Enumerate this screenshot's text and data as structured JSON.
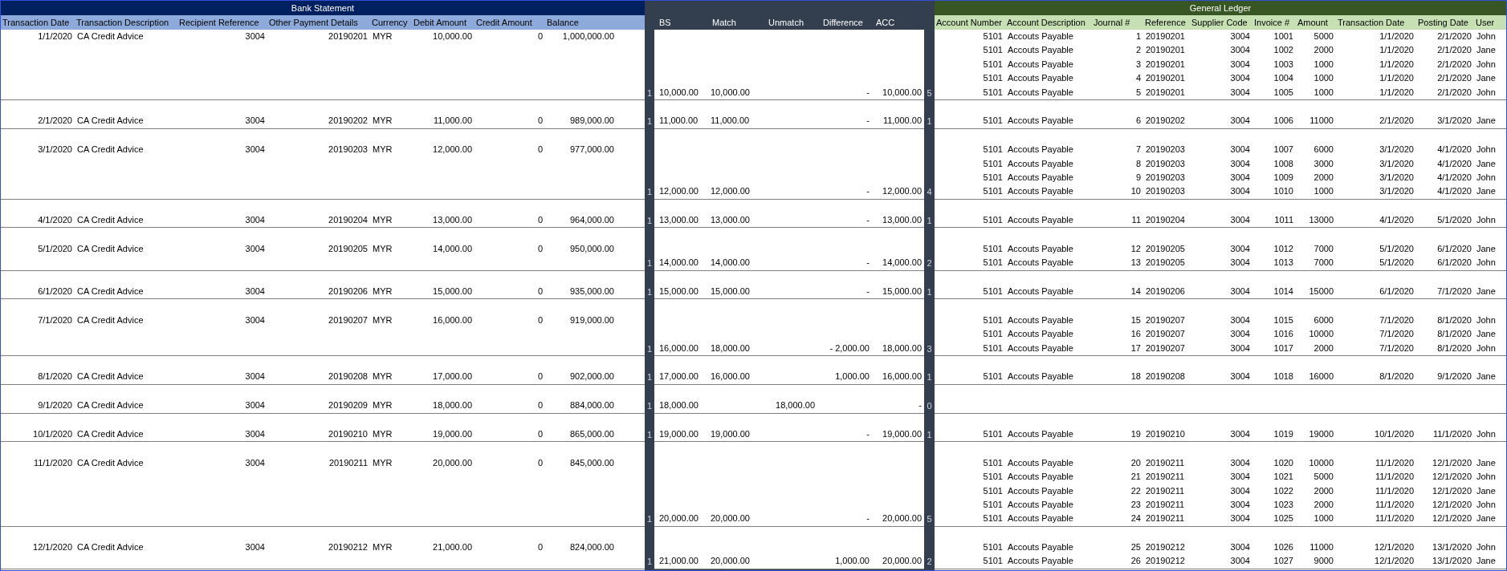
{
  "bank_statement": {
    "title": "Bank Statement",
    "columns": [
      "Transaction Date",
      "Transaction Description",
      "Recipient Reference",
      "Other Payment Details",
      "Currency",
      "Debit Amount",
      "Credit Amount",
      "Balance"
    ]
  },
  "reconciliation": {
    "columns": [
      "BS",
      "Match",
      "Unmatch",
      "Difference",
      "ACC"
    ]
  },
  "general_ledger": {
    "title": "General Ledger",
    "columns": [
      "Account Number",
      "Account Description",
      "Journal #",
      "Reference",
      "Supplier Code",
      "Invoice #",
      "Amount",
      "Transaction Date",
      "Posting Date",
      "User"
    ]
  },
  "groups": [
    {
      "blank_first_line": false,
      "bank": [
        "1/1/2020",
        "CA Credit Advice",
        "3004",
        "20190201",
        "MYR",
        "10,000.00",
        "0",
        "1,000,000.00"
      ],
      "bs_count": "1",
      "recon": {
        "bs": "10,000.00",
        "match": "10,000.00",
        "difference": "-",
        "acc": "10,000.00"
      },
      "gl_count": "5",
      "gl": [
        [
          "5101",
          "Accouts Payable",
          "1",
          "20190201",
          "3004",
          "1001",
          "5000",
          "1/1/2020",
          "2/1/2020",
          "John"
        ],
        [
          "5101",
          "Accouts Payable",
          "2",
          "20190201",
          "3004",
          "1002",
          "2000",
          "1/1/2020",
          "2/1/2020",
          "Jane"
        ],
        [
          "5101",
          "Accouts Payable",
          "3",
          "20190201",
          "3004",
          "1003",
          "1000",
          "1/1/2020",
          "2/1/2020",
          "John"
        ],
        [
          "5101",
          "Accouts Payable",
          "4",
          "20190201",
          "3004",
          "1004",
          "1000",
          "1/1/2020",
          "2/1/2020",
          "Jane"
        ],
        [
          "5101",
          "Accouts Payable",
          "5",
          "20190201",
          "3004",
          "1005",
          "1000",
          "1/1/2020",
          "2/1/2020",
          "John"
        ]
      ]
    },
    {
      "blank_first_line": true,
      "bank": [
        "2/1/2020",
        "CA Credit Advice",
        "3004",
        "20190202",
        "MYR",
        "11,000.00",
        "0",
        "989,000.00"
      ],
      "bs_count": "1",
      "recon": {
        "bs": "11,000.00",
        "match": "11,000.00",
        "difference": "-",
        "acc": "11,000.00"
      },
      "gl_count": "1",
      "gl": [
        [
          "5101",
          "Accouts Payable",
          "6",
          "20190202",
          "3004",
          "1006",
          "11000",
          "2/1/2020",
          "3/1/2020",
          "Jane"
        ]
      ]
    },
    {
      "blank_first_line": true,
      "bank": [
        "3/1/2020",
        "CA Credit Advice",
        "3004",
        "20190203",
        "MYR",
        "12,000.00",
        "0",
        "977,000.00"
      ],
      "bs_count": "1",
      "recon": {
        "bs": "12,000.00",
        "match": "12,000.00",
        "difference": "-",
        "acc": "12,000.00"
      },
      "gl_count": "4",
      "gl": [
        [
          "5101",
          "Accouts Payable",
          "7",
          "20190203",
          "3004",
          "1007",
          "6000",
          "3/1/2020",
          "4/1/2020",
          "John"
        ],
        [
          "5101",
          "Accouts Payable",
          "8",
          "20190203",
          "3004",
          "1008",
          "3000",
          "3/1/2020",
          "4/1/2020",
          "Jane"
        ],
        [
          "5101",
          "Accouts Payable",
          "9",
          "20190203",
          "3004",
          "1009",
          "2000",
          "3/1/2020",
          "4/1/2020",
          "John"
        ],
        [
          "5101",
          "Accouts Payable",
          "10",
          "20190203",
          "3004",
          "1010",
          "1000",
          "3/1/2020",
          "4/1/2020",
          "Jane"
        ]
      ]
    },
    {
      "blank_first_line": true,
      "bank": [
        "4/1/2020",
        "CA Credit Advice",
        "3004",
        "20190204",
        "MYR",
        "13,000.00",
        "0",
        "964,000.00"
      ],
      "bs_count": "1",
      "recon": {
        "bs": "13,000.00",
        "match": "13,000.00",
        "difference": "-",
        "acc": "13,000.00"
      },
      "gl_count": "1",
      "gl": [
        [
          "5101",
          "Accouts Payable",
          "11",
          "20190204",
          "3004",
          "1011",
          "13000",
          "4/1/2020",
          "5/1/2020",
          "John"
        ]
      ]
    },
    {
      "blank_first_line": true,
      "bank": [
        "5/1/2020",
        "CA Credit Advice",
        "3004",
        "20190205",
        "MYR",
        "14,000.00",
        "0",
        "950,000.00"
      ],
      "bs_count": "1",
      "recon": {
        "bs": "14,000.00",
        "match": "14,000.00",
        "difference": "-",
        "acc": "14,000.00"
      },
      "gl_count": "2",
      "gl": [
        [
          "5101",
          "Accouts Payable",
          "12",
          "20190205",
          "3004",
          "1012",
          "7000",
          "5/1/2020",
          "6/1/2020",
          "Jane"
        ],
        [
          "5101",
          "Accouts Payable",
          "13",
          "20190205",
          "3004",
          "1013",
          "7000",
          "5/1/2020",
          "6/1/2020",
          "John"
        ]
      ]
    },
    {
      "blank_first_line": true,
      "bank": [
        "6/1/2020",
        "CA Credit Advice",
        "3004",
        "20190206",
        "MYR",
        "15,000.00",
        "0",
        "935,000.00"
      ],
      "bs_count": "1",
      "recon": {
        "bs": "15,000.00",
        "match": "15,000.00",
        "difference": "-",
        "acc": "15,000.00"
      },
      "gl_count": "1",
      "gl": [
        [
          "5101",
          "Accouts Payable",
          "14",
          "20190206",
          "3004",
          "1014",
          "15000",
          "6/1/2020",
          "7/1/2020",
          "Jane"
        ]
      ]
    },
    {
      "blank_first_line": true,
      "bank": [
        "7/1/2020",
        "CA Credit Advice",
        "3004",
        "20190207",
        "MYR",
        "16,000.00",
        "0",
        "919,000.00"
      ],
      "bs_count": "1",
      "recon": {
        "bs": "16,000.00",
        "match": "18,000.00",
        "difference": "- 2,000.00",
        "acc": "18,000.00"
      },
      "gl_count": "3",
      "gl": [
        [
          "5101",
          "Accouts Payable",
          "15",
          "20190207",
          "3004",
          "1015",
          "6000",
          "7/1/2020",
          "8/1/2020",
          "John"
        ],
        [
          "5101",
          "Accouts Payable",
          "16",
          "20190207",
          "3004",
          "1016",
          "10000",
          "7/1/2020",
          "8/1/2020",
          "Jane"
        ],
        [
          "5101",
          "Accouts Payable",
          "17",
          "20190207",
          "3004",
          "1017",
          "2000",
          "7/1/2020",
          "8/1/2020",
          "John"
        ]
      ]
    },
    {
      "blank_first_line": true,
      "bank": [
        "8/1/2020",
        "CA Credit Advice",
        "3004",
        "20190208",
        "MYR",
        "17,000.00",
        "0",
        "902,000.00"
      ],
      "bs_count": "1",
      "recon": {
        "bs": "17,000.00",
        "match": "16,000.00",
        "difference": "1,000.00",
        "acc": "16,000.00"
      },
      "gl_count": "1",
      "gl": [
        [
          "5101",
          "Accouts Payable",
          "18",
          "20190208",
          "3004",
          "1018",
          "16000",
          "8/1/2020",
          "9/1/2020",
          "Jane"
        ]
      ]
    },
    {
      "blank_first_line": true,
      "bank": [
        "9/1/2020",
        "CA Credit Advice",
        "3004",
        "20190209",
        "MYR",
        "18,000.00",
        "0",
        "884,000.00"
      ],
      "bs_count": "1",
      "recon": {
        "bs": "18,000.00",
        "unmatch": "18,000.00",
        "acc": "-"
      },
      "gl_count": "0"
    },
    {
      "blank_first_line": true,
      "bank": [
        "10/1/2020",
        "CA Credit Advice",
        "3004",
        "20190210",
        "MYR",
        "19,000.00",
        "0",
        "865,000.00"
      ],
      "bs_count": "1",
      "recon": {
        "bs": "19,000.00",
        "match": "19,000.00",
        "difference": "-",
        "acc": "19,000.00"
      },
      "gl_count": "1",
      "gl": [
        [
          "5101",
          "Accouts Payable",
          "19",
          "20190210",
          "3004",
          "1019",
          "19000",
          "10/1/2020",
          "11/1/2020",
          "John"
        ]
      ]
    },
    {
      "blank_first_line": true,
      "bank": [
        "11/1/2020",
        "CA Credit Advice",
        "3004",
        "20190211",
        "MYR",
        "20,000.00",
        "0",
        "845,000.00"
      ],
      "bs_count": "1",
      "recon": {
        "bs": "20,000.00",
        "match": "20,000.00",
        "difference": "-",
        "acc": "20,000.00"
      },
      "gl_count": "5",
      "gl": [
        [
          "5101",
          "Accouts Payable",
          "20",
          "20190211",
          "3004",
          "1020",
          "10000",
          "11/1/2020",
          "12/1/2020",
          "Jane"
        ],
        [
          "5101",
          "Accouts Payable",
          "21",
          "20190211",
          "3004",
          "1021",
          "5000",
          "11/1/2020",
          "12/1/2020",
          "John"
        ],
        [
          "5101",
          "Accouts Payable",
          "22",
          "20190211",
          "3004",
          "1022",
          "2000",
          "11/1/2020",
          "12/1/2020",
          "Jane"
        ],
        [
          "5101",
          "Accouts Payable",
          "23",
          "20190211",
          "3004",
          "1023",
          "2000",
          "11/1/2020",
          "12/1/2020",
          "John"
        ],
        [
          "5101",
          "Accouts Payable",
          "24",
          "20190211",
          "3004",
          "1025",
          "1000",
          "11/1/2020",
          "12/1/2020",
          "Jane"
        ]
      ]
    },
    {
      "blank_first_line": true,
      "bank": [
        "12/1/2020",
        "CA Credit Advice",
        "3004",
        "20190212",
        "MYR",
        "21,000.00",
        "0",
        "824,000.00"
      ],
      "bs_count": "1",
      "recon": {
        "bs": "21,000.00",
        "match": "20,000.00",
        "difference": "1,000.00",
        "acc": "20,000.00"
      },
      "gl_count": "2",
      "gl": [
        [
          "5101",
          "Accouts Payable",
          "25",
          "20190212",
          "3004",
          "1026",
          "11000",
          "12/1/2020",
          "13/1/2020",
          "John"
        ],
        [
          "5101",
          "Accouts Payable",
          "26",
          "20190212",
          "3004",
          "1027",
          "9000",
          "12/1/2020",
          "13/1/2020",
          "Jane"
        ]
      ]
    }
  ]
}
